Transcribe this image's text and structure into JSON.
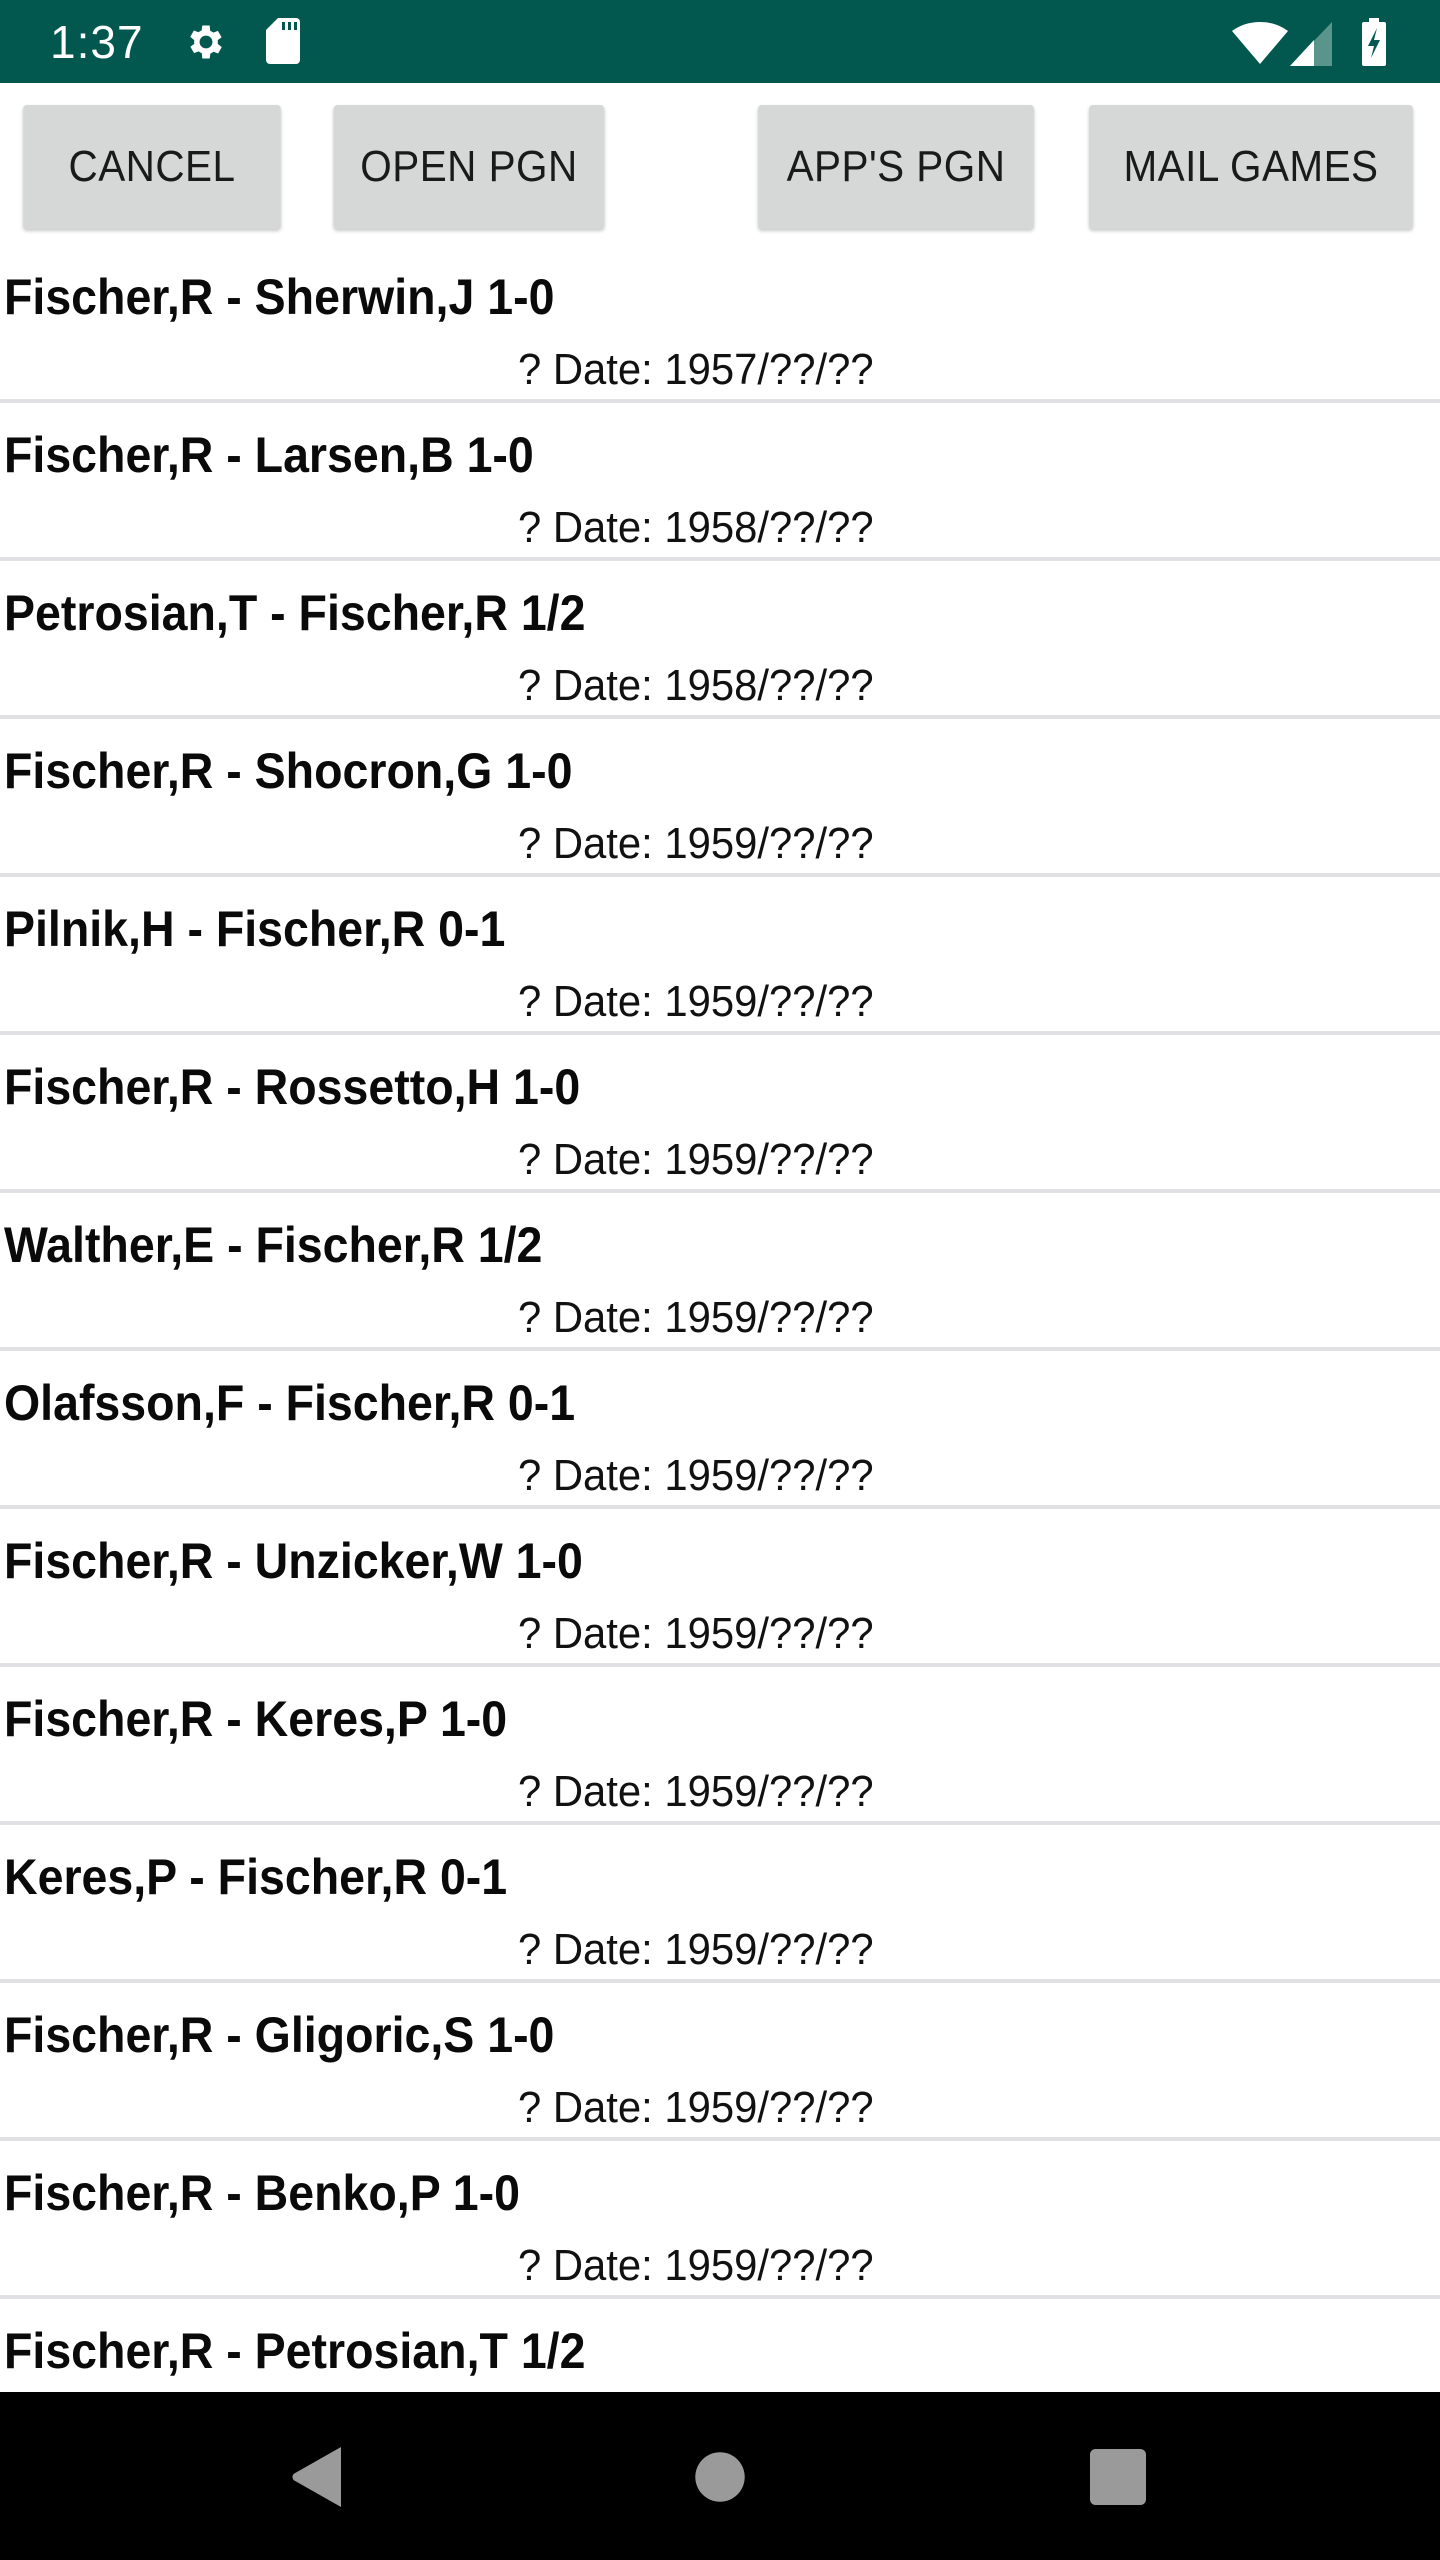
{
  "status_bar": {
    "time": "1:37",
    "background_color": "#02584f",
    "left_icons": [
      "settings-gear-icon",
      "sd-card-icon"
    ],
    "right_icons": [
      "wifi-icon",
      "cellular-signal-icon",
      "battery-charging-icon"
    ]
  },
  "toolbar": {
    "buttons": [
      {
        "id": "cancel",
        "label": "CANCEL"
      },
      {
        "id": "open_pgn",
        "label": "OPEN PGN"
      },
      {
        "id": "apps_pgn",
        "label": "APP'S PGN"
      },
      {
        "id": "mail_games",
        "label": "MAIL GAMES"
      }
    ]
  },
  "games": [
    {
      "title": "Fischer,R - Sherwin,J 1-0",
      "date": "? Date: 1957/??/??"
    },
    {
      "title": "Fischer,R - Larsen,B 1-0",
      "date": "? Date: 1958/??/??"
    },
    {
      "title": "Petrosian,T - Fischer,R 1/2",
      "date": "? Date: 1958/??/??"
    },
    {
      "title": "Fischer,R - Shocron,G 1-0",
      "date": "? Date: 1959/??/??"
    },
    {
      "title": "Pilnik,H - Fischer,R 0-1",
      "date": "? Date: 1959/??/??"
    },
    {
      "title": "Fischer,R - Rossetto,H 1-0",
      "date": "? Date: 1959/??/??"
    },
    {
      "title": "Walther,E - Fischer,R 1/2",
      "date": "? Date: 1959/??/??"
    },
    {
      "title": "Olafsson,F - Fischer,R 0-1",
      "date": "? Date: 1959/??/??"
    },
    {
      "title": "Fischer,R - Unzicker,W 1-0",
      "date": "? Date: 1959/??/??"
    },
    {
      "title": "Fischer,R - Keres,P 1-0",
      "date": "? Date: 1959/??/??"
    },
    {
      "title": "Keres,P - Fischer,R 0-1",
      "date": "? Date: 1959/??/??"
    },
    {
      "title": "Fischer,R - Gligoric,S 1-0",
      "date": "? Date: 1959/??/??"
    },
    {
      "title": "Fischer,R - Benko,P 1-0",
      "date": "? Date: 1959/??/??"
    },
    {
      "title": "Fischer,R - Petrosian,T 1/2",
      "date": ""
    }
  ],
  "nav_bar": {
    "buttons": [
      "back-icon",
      "home-icon",
      "recents-icon"
    ]
  }
}
